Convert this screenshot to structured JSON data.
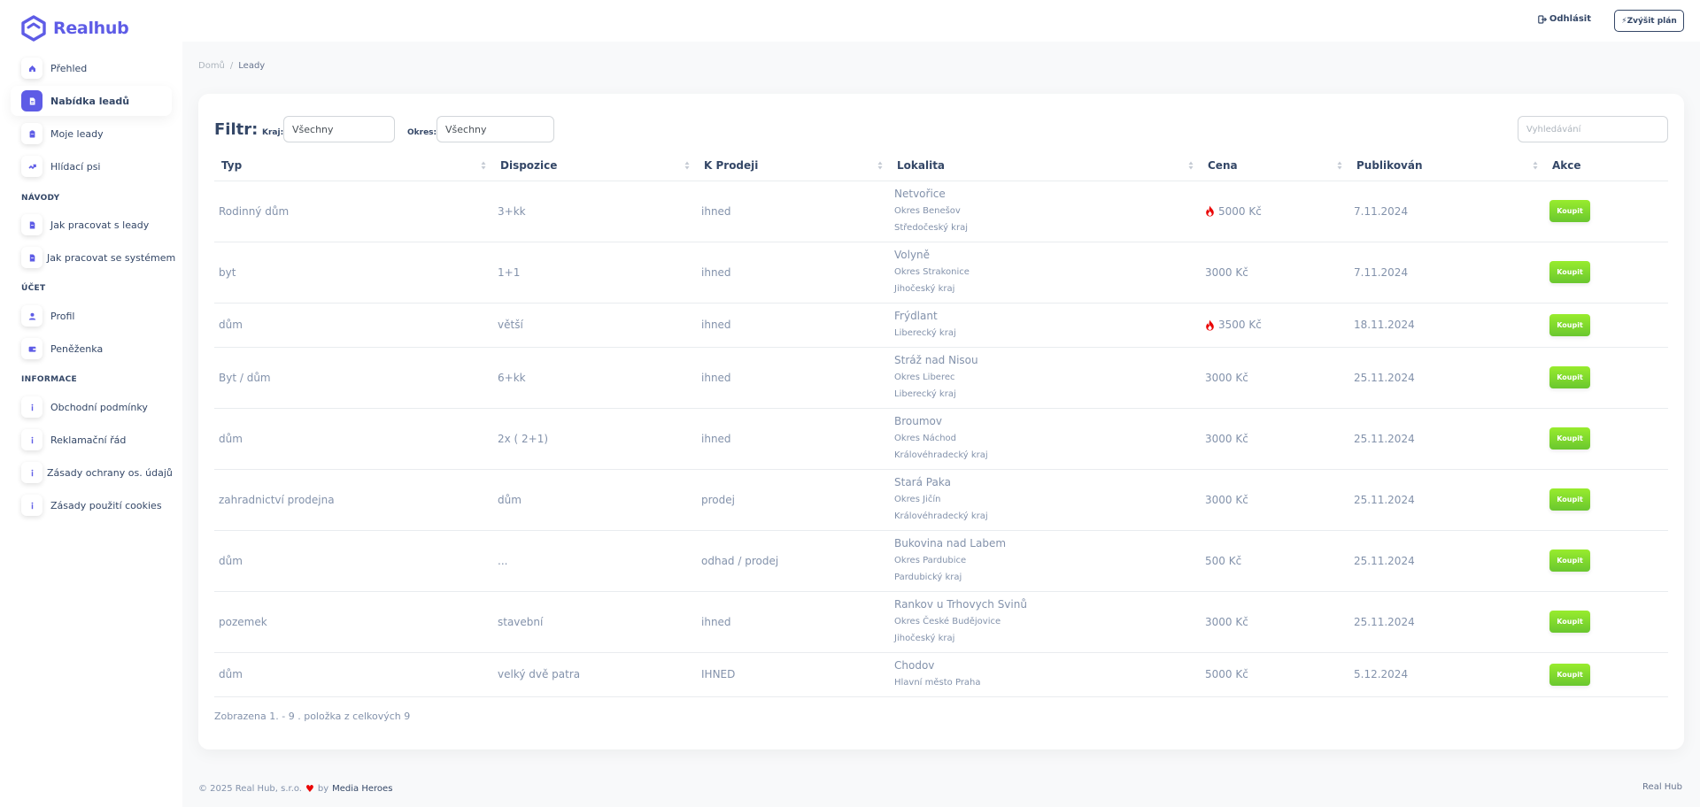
{
  "brand": {
    "name": "Realhub",
    "color": "#5e5ce6"
  },
  "sidebar": {
    "items_main": [
      {
        "label": "Přehled",
        "icon": "home-icon"
      },
      {
        "label": "Nabídka leadů",
        "icon": "document-icon",
        "active": true
      },
      {
        "label": "Moje leady",
        "icon": "clipboard-icon"
      },
      {
        "label": "Hlídací psi",
        "icon": "dog-icon"
      }
    ],
    "section_guides": "NÁVODY",
    "items_guides": [
      {
        "label": "Jak pracovat s leady",
        "icon": "file-icon"
      },
      {
        "label": "Jak pracovat se systémem",
        "icon": "file-icon"
      }
    ],
    "section_account": "ÚČET",
    "items_account": [
      {
        "label": "Profil",
        "icon": "user-icon"
      },
      {
        "label": "Peněženka",
        "icon": "wallet-icon"
      }
    ],
    "section_info": "INFORMACE",
    "items_info": [
      {
        "label": "Obchodní podmínky",
        "icon": "info-icon"
      },
      {
        "label": "Reklamační řád",
        "icon": "info-icon"
      },
      {
        "label": "Zásady ochrany os. údajů",
        "icon": "info-icon"
      },
      {
        "label": "Zásady použití cookies",
        "icon": "info-icon"
      }
    ]
  },
  "topbar": {
    "logout_label": "Odhlásit",
    "upgrade_label": "Zvýšit plán"
  },
  "breadcrumb": {
    "home": "Domů",
    "separator": "/",
    "current": "Leady"
  },
  "filter": {
    "title": "Filtr:",
    "region_label": "Kraj:",
    "region_value": "Všechny",
    "district_label": "Okres:",
    "district_value": "Všechny",
    "search_placeholder": "Vyhledávání"
  },
  "table": {
    "columns": [
      "Typ",
      "Dispozice",
      "K Prodeji",
      "Lokalita",
      "Cena",
      "Publikován",
      "Akce"
    ],
    "buy_label": "Koupit",
    "rows": [
      {
        "typ": "Rodinný dům",
        "dispozice": "3+kk",
        "k_prodeji": "ihned",
        "lokalita": [
          "Netvořice",
          "Okres Benešov",
          "Středočeský kraj"
        ],
        "cena": "5000 Kč",
        "hot": true,
        "publikovan": "7.11.2024"
      },
      {
        "typ": "byt",
        "dispozice": "1+1",
        "k_prodeji": "ihned",
        "lokalita": [
          "Volyně",
          "Okres Strakonice",
          "Jihočeský kraj"
        ],
        "cena": "3000 Kč",
        "hot": false,
        "publikovan": "7.11.2024"
      },
      {
        "typ": "dům",
        "dispozice": "větší",
        "k_prodeji": "ihned",
        "lokalita": [
          "Frýdlant",
          "Liberecký kraj"
        ],
        "cena": "3500 Kč",
        "hot": true,
        "publikovan": "18.11.2024"
      },
      {
        "typ": "Byt / dům",
        "dispozice": "6+kk",
        "k_prodeji": "ihned",
        "lokalita": [
          "Stráž nad Nisou",
          "Okres Liberec",
          "Liberecký kraj"
        ],
        "cena": "3000 Kč",
        "hot": false,
        "publikovan": "25.11.2024"
      },
      {
        "typ": "dům",
        "dispozice": "2x ( 2+1)",
        "k_prodeji": "ihned",
        "lokalita": [
          "Broumov",
          "Okres Náchod",
          "Královéhradecký kraj"
        ],
        "cena": "3000 Kč",
        "hot": false,
        "publikovan": "25.11.2024"
      },
      {
        "typ": "zahradnictví prodejna",
        "dispozice": "dům",
        "k_prodeji": "prodej",
        "lokalita": [
          "Stará Paka",
          "Okres Jičín",
          "Královéhradecký kraj"
        ],
        "cena": "3000 Kč",
        "hot": false,
        "publikovan": "25.11.2024"
      },
      {
        "typ": "dům",
        "dispozice": "...",
        "k_prodeji": "odhad / prodej",
        "lokalita": [
          "Bukovina nad Labem",
          "Okres Pardubice",
          "Pardubický kraj"
        ],
        "cena": "500 Kč",
        "hot": false,
        "publikovan": "25.11.2024"
      },
      {
        "typ": "pozemek",
        "dispozice": "stavební",
        "k_prodeji": "ihned",
        "lokalita": [
          "Rankov u Trhovych Svinů",
          "Okres České Budějovice",
          "Jihočeský kraj"
        ],
        "cena": "3000 Kč",
        "hot": false,
        "publikovan": "25.11.2024"
      },
      {
        "typ": "dům",
        "dispozice": "velký dvě patra",
        "k_prodeji": "IHNED",
        "lokalita": [
          "Chodov",
          "Hlavní město Praha"
        ],
        "cena": "5000 Kč",
        "hot": false,
        "publikovan": "5.12.2024"
      }
    ]
  },
  "summary": "Zobrazena 1. - 9 . položka z celkových 9",
  "footer": {
    "copyright": "© 2025 Real Hub, s.r.o.",
    "by": "by",
    "author": "Media Heroes",
    "right": "Real Hub"
  },
  "colors": {
    "accent": "#5e5ce6",
    "buy_button": "#7ed32f",
    "hot": "#ea0606",
    "text_dark": "#344767"
  }
}
